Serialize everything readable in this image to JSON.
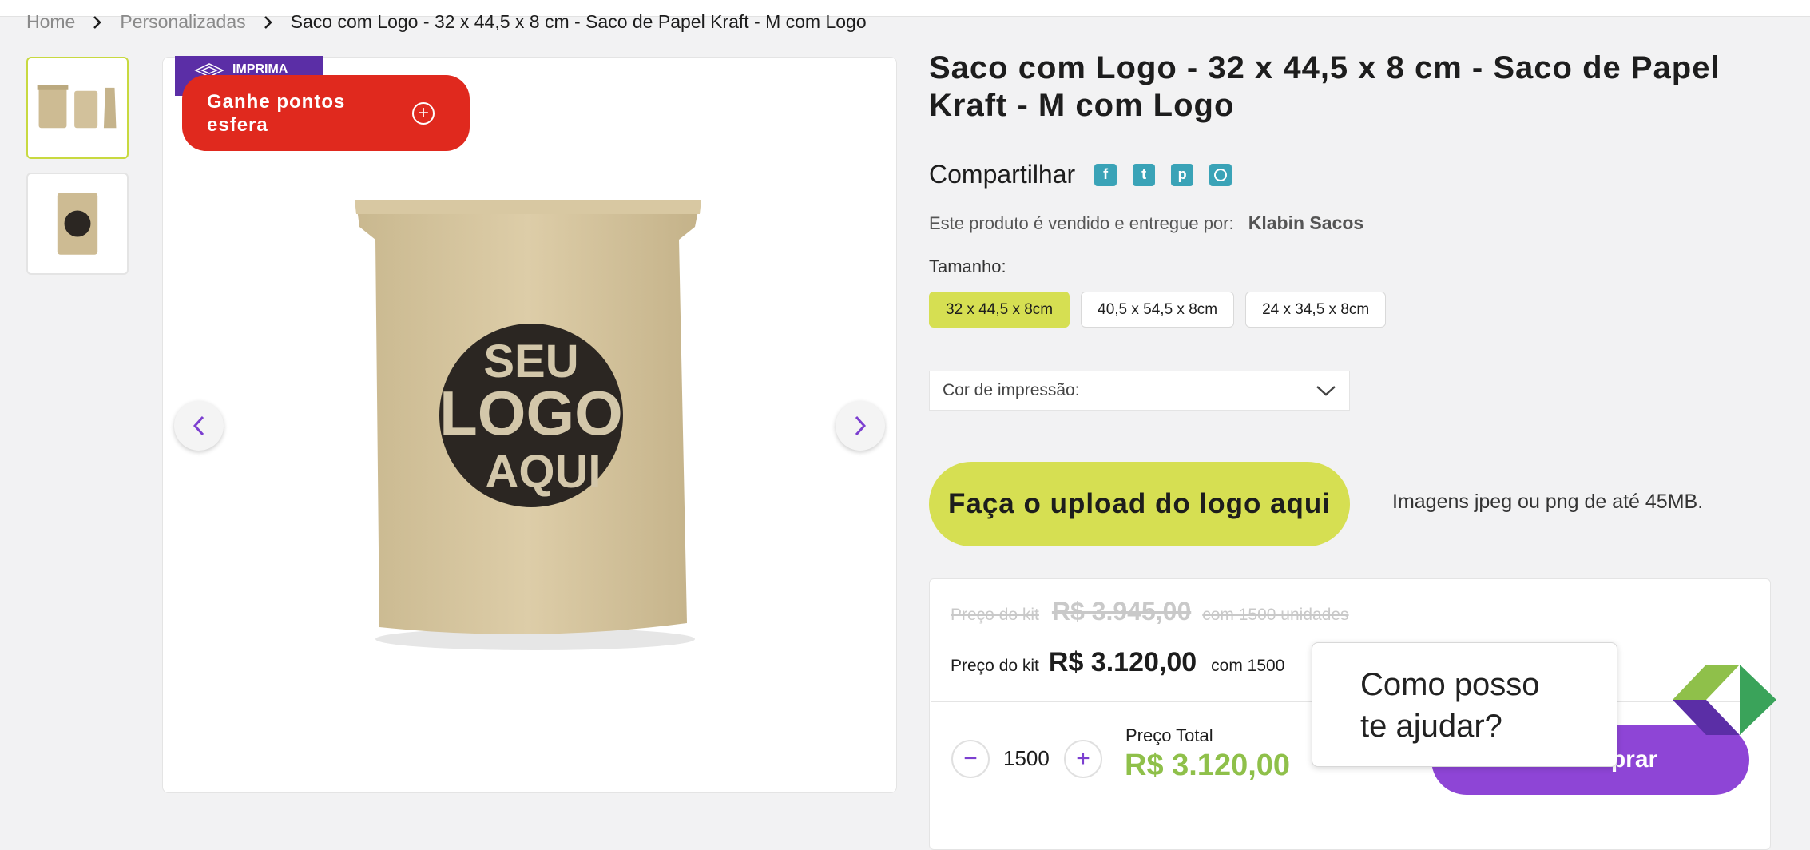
{
  "breadcrumb": {
    "items": [
      "Home",
      "Personalizadas"
    ],
    "current": "Saco com Logo - 32 x 44,5 x 8 cm - Saco de Papel Kraft - M com Logo"
  },
  "gallery": {
    "badge": "IMPRIMA",
    "points_button": "Ganhe pontos esfera",
    "image_text": [
      "SEU",
      "LOGO",
      "AQUI"
    ]
  },
  "product": {
    "title": "Saco com Logo - 32 x 44,5 x 8 cm - Saco de Papel Kraft - M com Logo",
    "share_label": "Compartilhar",
    "share_icons": [
      "facebook-icon",
      "twitter-icon",
      "pinterest-icon",
      "whatsapp-icon"
    ],
    "seller_label": "Este produto é vendido e entregue por:",
    "seller_name": "Klabin Sacos",
    "size_label": "Tamanho:",
    "sizes": [
      "32 x 44,5 x 8cm",
      "40,5 x 54,5 x 8cm",
      "24 x 34,5 x 8cm"
    ],
    "selected_size": "32 x 44,5 x 8cm",
    "color_label": "Cor de impressão:",
    "upload_button": "Faça o upload do logo aqui",
    "upload_note": "Imagens jpeg ou png de até 45MB."
  },
  "pricing": {
    "old_label": "Preço do kit",
    "old_price": "R$ 3.945,00",
    "old_units": "com 1500 unidades",
    "kit_label": "Preço do kit",
    "kit_price": "R$ 3.120,00",
    "kit_units": "com 1500",
    "quantity": "1500",
    "minus": "−",
    "plus": "+",
    "total_label": "Preço Total",
    "total_price": "R$ 3.120,00",
    "buy_button": "prar"
  },
  "chat": {
    "bubble_line1": "Como posso",
    "bubble_line2": "te ajudar?"
  },
  "colors": {
    "accent_green": "#d6df52",
    "brand_purple": "#8e45d6",
    "points_red": "#e0291e",
    "total_green": "#8fc04a"
  }
}
